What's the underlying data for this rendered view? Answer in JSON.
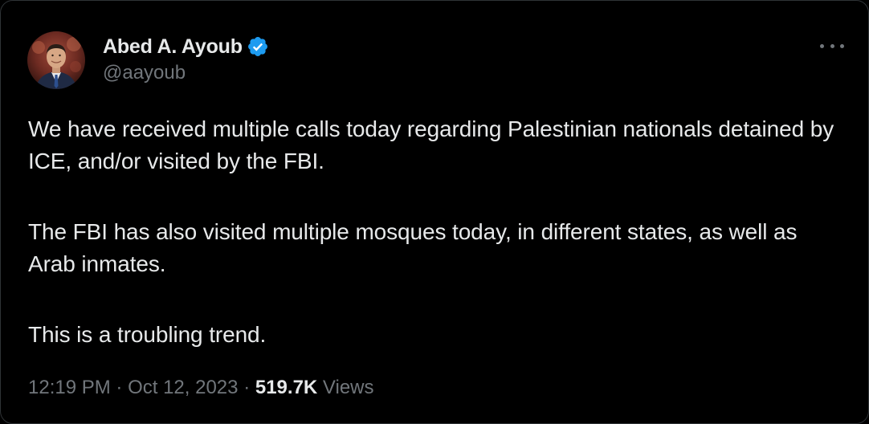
{
  "author": {
    "display_name": "Abed A. Ayoub",
    "handle": "@aayoub",
    "verified": true,
    "verified_color": "#1d9bf0"
  },
  "more_icon": "ellipsis-icon",
  "tweet": {
    "paragraphs": [
      "We have received multiple calls today regarding Palestinian nationals detained by ICE, and/or visited by the FBI.",
      "The FBI has also visited multiple mosques today, in different states, as well as Arab inmates.",
      "This is a troubling trend."
    ]
  },
  "meta": {
    "time": "12:19 PM",
    "separator1": "·",
    "date": "Oct 12, 2023",
    "separator2": "·",
    "views_count": "519.7K",
    "views_label": "Views"
  },
  "colors": {
    "background": "#000000",
    "text_primary": "#e7e9ea",
    "text_secondary": "#71767b"
  }
}
